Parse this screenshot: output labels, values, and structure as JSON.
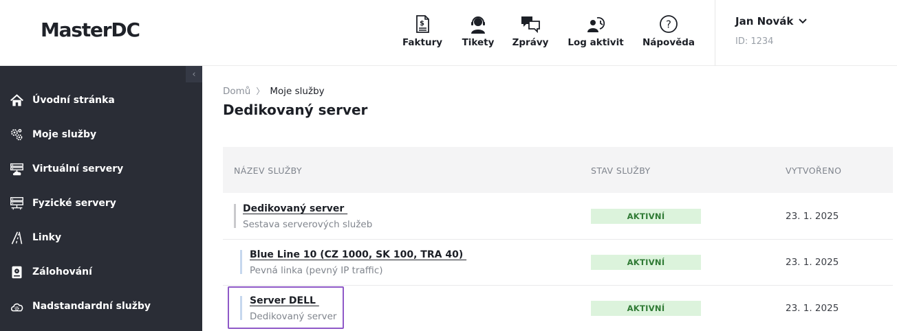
{
  "header": {
    "logo": "MasterDC",
    "nav": [
      {
        "label": "Faktury",
        "icon": "invoice-icon"
      },
      {
        "label": "Tikety",
        "icon": "support-agent-icon"
      },
      {
        "label": "Zprávy",
        "icon": "chat-bubbles-icon"
      },
      {
        "label": "Log aktivit",
        "icon": "activity-log-icon"
      },
      {
        "label": "Nápověda",
        "icon": "help-icon"
      }
    ],
    "user": {
      "name": "Jan Novák",
      "id": "ID: 1234"
    }
  },
  "sidebar": {
    "collapse_glyph": "‹",
    "items": [
      {
        "label": "Úvodní stránka",
        "icon": "home-icon"
      },
      {
        "label": "Moje služby",
        "icon": "gears-icon"
      },
      {
        "label": "Virtuální servery",
        "icon": "virtual-server-icon"
      },
      {
        "label": "Fyzické servery",
        "icon": "physical-server-icon"
      },
      {
        "label": "Linky",
        "icon": "road-icon"
      },
      {
        "label": "Zálohování",
        "icon": "backup-drive-icon"
      },
      {
        "label": "Nadstandardní služby",
        "icon": "cloud-settings-icon"
      }
    ]
  },
  "breadcrumb": {
    "home": "Domů",
    "separator": "〉",
    "current": "Moje služby"
  },
  "page_title": "Dedikovaný server",
  "table": {
    "columns": [
      "NÁZEV SLUŽBY",
      "STAV SLUŽBY",
      "VYTVOŘENO"
    ],
    "rows": [
      {
        "name": "Dedikovaný server ",
        "subtitle": "Sestava serverových služeb",
        "status": "AKTIVNÍ",
        "created": "23. 1. 2025"
      },
      {
        "name": "Blue Line 10 (CZ 1000, SK 100, TRA 40) ",
        "subtitle": "Pevná linka (pevný IP traffic)",
        "status": "AKTIVNÍ",
        "created": "23. 1. 2025"
      },
      {
        "name": "Server DELL ",
        "subtitle": "Dedikovaný server",
        "status": "AKTIVNÍ",
        "created": "23. 1. 2025"
      }
    ]
  },
  "colors": {
    "sidebar_bg": "#2a2d36",
    "status_bg": "#dcf3dc",
    "status_text": "#2f7a34",
    "highlight": "#8e58c7",
    "parent_bar": "#c9c9cc",
    "child_bar": "#c6d7ee"
  }
}
